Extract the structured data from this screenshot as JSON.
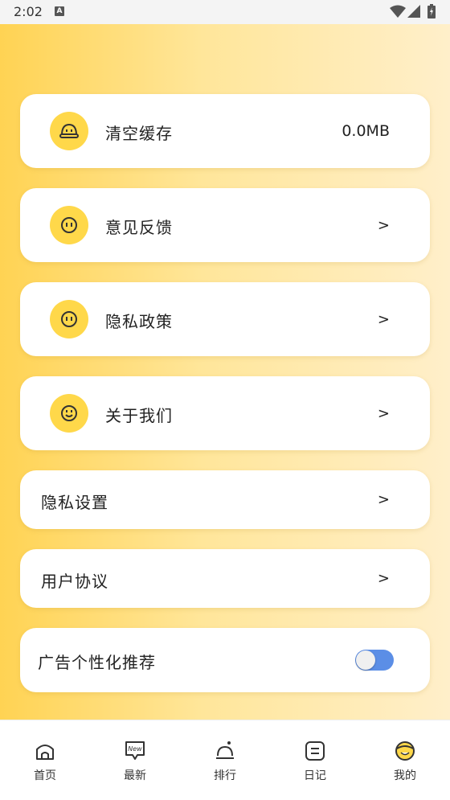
{
  "status_bar": {
    "time": "2:02",
    "notif_glyph": "A"
  },
  "settings": {
    "clear_cache": {
      "label": "清空缓存",
      "value": "0.0MB",
      "icon": "cache-icon"
    },
    "feedback": {
      "label": "意见反馈",
      "arrow": ">",
      "icon": "feedback-icon"
    },
    "privacy_policy": {
      "label": "隐私政策",
      "arrow": ">",
      "icon": "privacy-icon"
    },
    "about_us": {
      "label": "关于我们",
      "arrow": ">",
      "icon": "smile-icon"
    },
    "privacy_settings": {
      "label": "隐私设置",
      "arrow": ">"
    },
    "user_agreement": {
      "label": "用户协议",
      "arrow": ">"
    },
    "personalized_ads": {
      "label": "广告个性化推荐",
      "enabled": true
    }
  },
  "bottom_nav": {
    "items": [
      {
        "label": "首页",
        "icon": "home-icon"
      },
      {
        "label": "最新",
        "icon": "new-icon"
      },
      {
        "label": "排行",
        "icon": "ranking-icon"
      },
      {
        "label": "日记",
        "icon": "diary-icon"
      },
      {
        "label": "我的",
        "icon": "profile-icon"
      }
    ]
  },
  "colors": {
    "accent_yellow": "#ffd84a",
    "toggle_on": "#5b8ee6",
    "gradient_start": "#ffd353",
    "gradient_end": "#ffefca"
  }
}
